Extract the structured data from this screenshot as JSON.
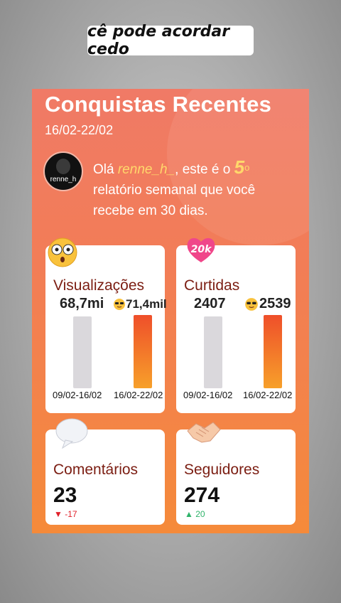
{
  "caption": "cê pode acordar cedo",
  "report": {
    "title": "Conquistas Recentes",
    "date_range": "16/02-22/02",
    "avatar_name": "renne_h",
    "greeting_prefix": "Olá ",
    "username": "renne_h_",
    "greeting_mid": ", este é o ",
    "ordinal_number": "5",
    "ordinal_suffix": "o",
    "greeting_suffix": " relatório semanal que você recebe em 30 dias."
  },
  "views": {
    "label": "Visualizações",
    "prev_value": "68,7mi",
    "curr_value": "71,4mil",
    "prev_date": "09/02-16/02",
    "curr_date": "16/02-22/02",
    "emoji": "surprised-face-icon"
  },
  "likes": {
    "label": "Curtidas",
    "prev_value": "2407",
    "curr_value": "2539",
    "prev_date": "09/02-16/02",
    "curr_date": "16/02-22/02",
    "badge": "20k"
  },
  "comments": {
    "label": "Comentários",
    "value": "23",
    "delta": "-17",
    "emoji": "speech-bubble-icon"
  },
  "followers": {
    "label": "Seguidores",
    "value": "274",
    "delta": "20",
    "emoji": "handshake-icon"
  },
  "colors": {
    "up": "#2fb36a",
    "down": "#e0202a",
    "accent": "#ffd86b"
  }
}
